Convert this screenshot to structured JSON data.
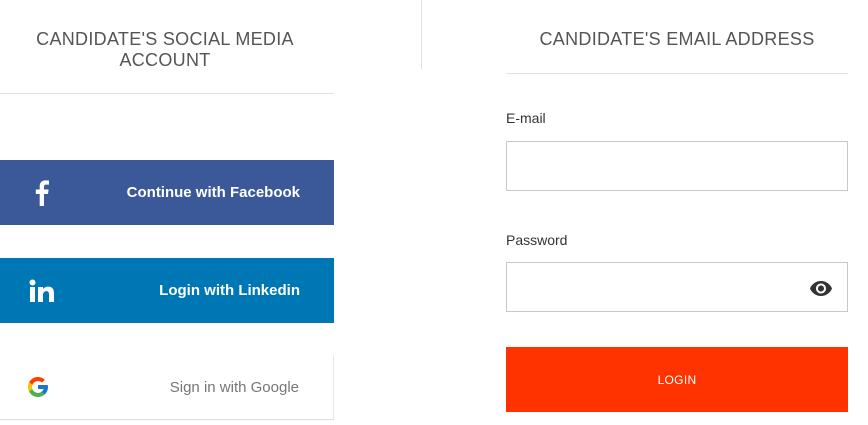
{
  "social": {
    "title": "CANDIDATE'S SOCIAL MEDIA ACCOUNT",
    "buttons": [
      {
        "label": "Continue with Facebook",
        "icon": "facebook-icon",
        "color": "#3b5998"
      },
      {
        "label": "Login with Linkedin",
        "icon": "linkedin-icon",
        "color": "#0077b5"
      },
      {
        "label": "Sign in with Google",
        "icon": "google-icon",
        "color": "#ffffff"
      }
    ]
  },
  "email": {
    "title": "CANDIDATE'S EMAIL ADDRESS",
    "email_label": "E-mail",
    "email_value": "",
    "password_label": "Password",
    "password_value": "",
    "password_icon": "eye-icon",
    "login_label": "LOGIN",
    "login_color": "#ff3300"
  }
}
